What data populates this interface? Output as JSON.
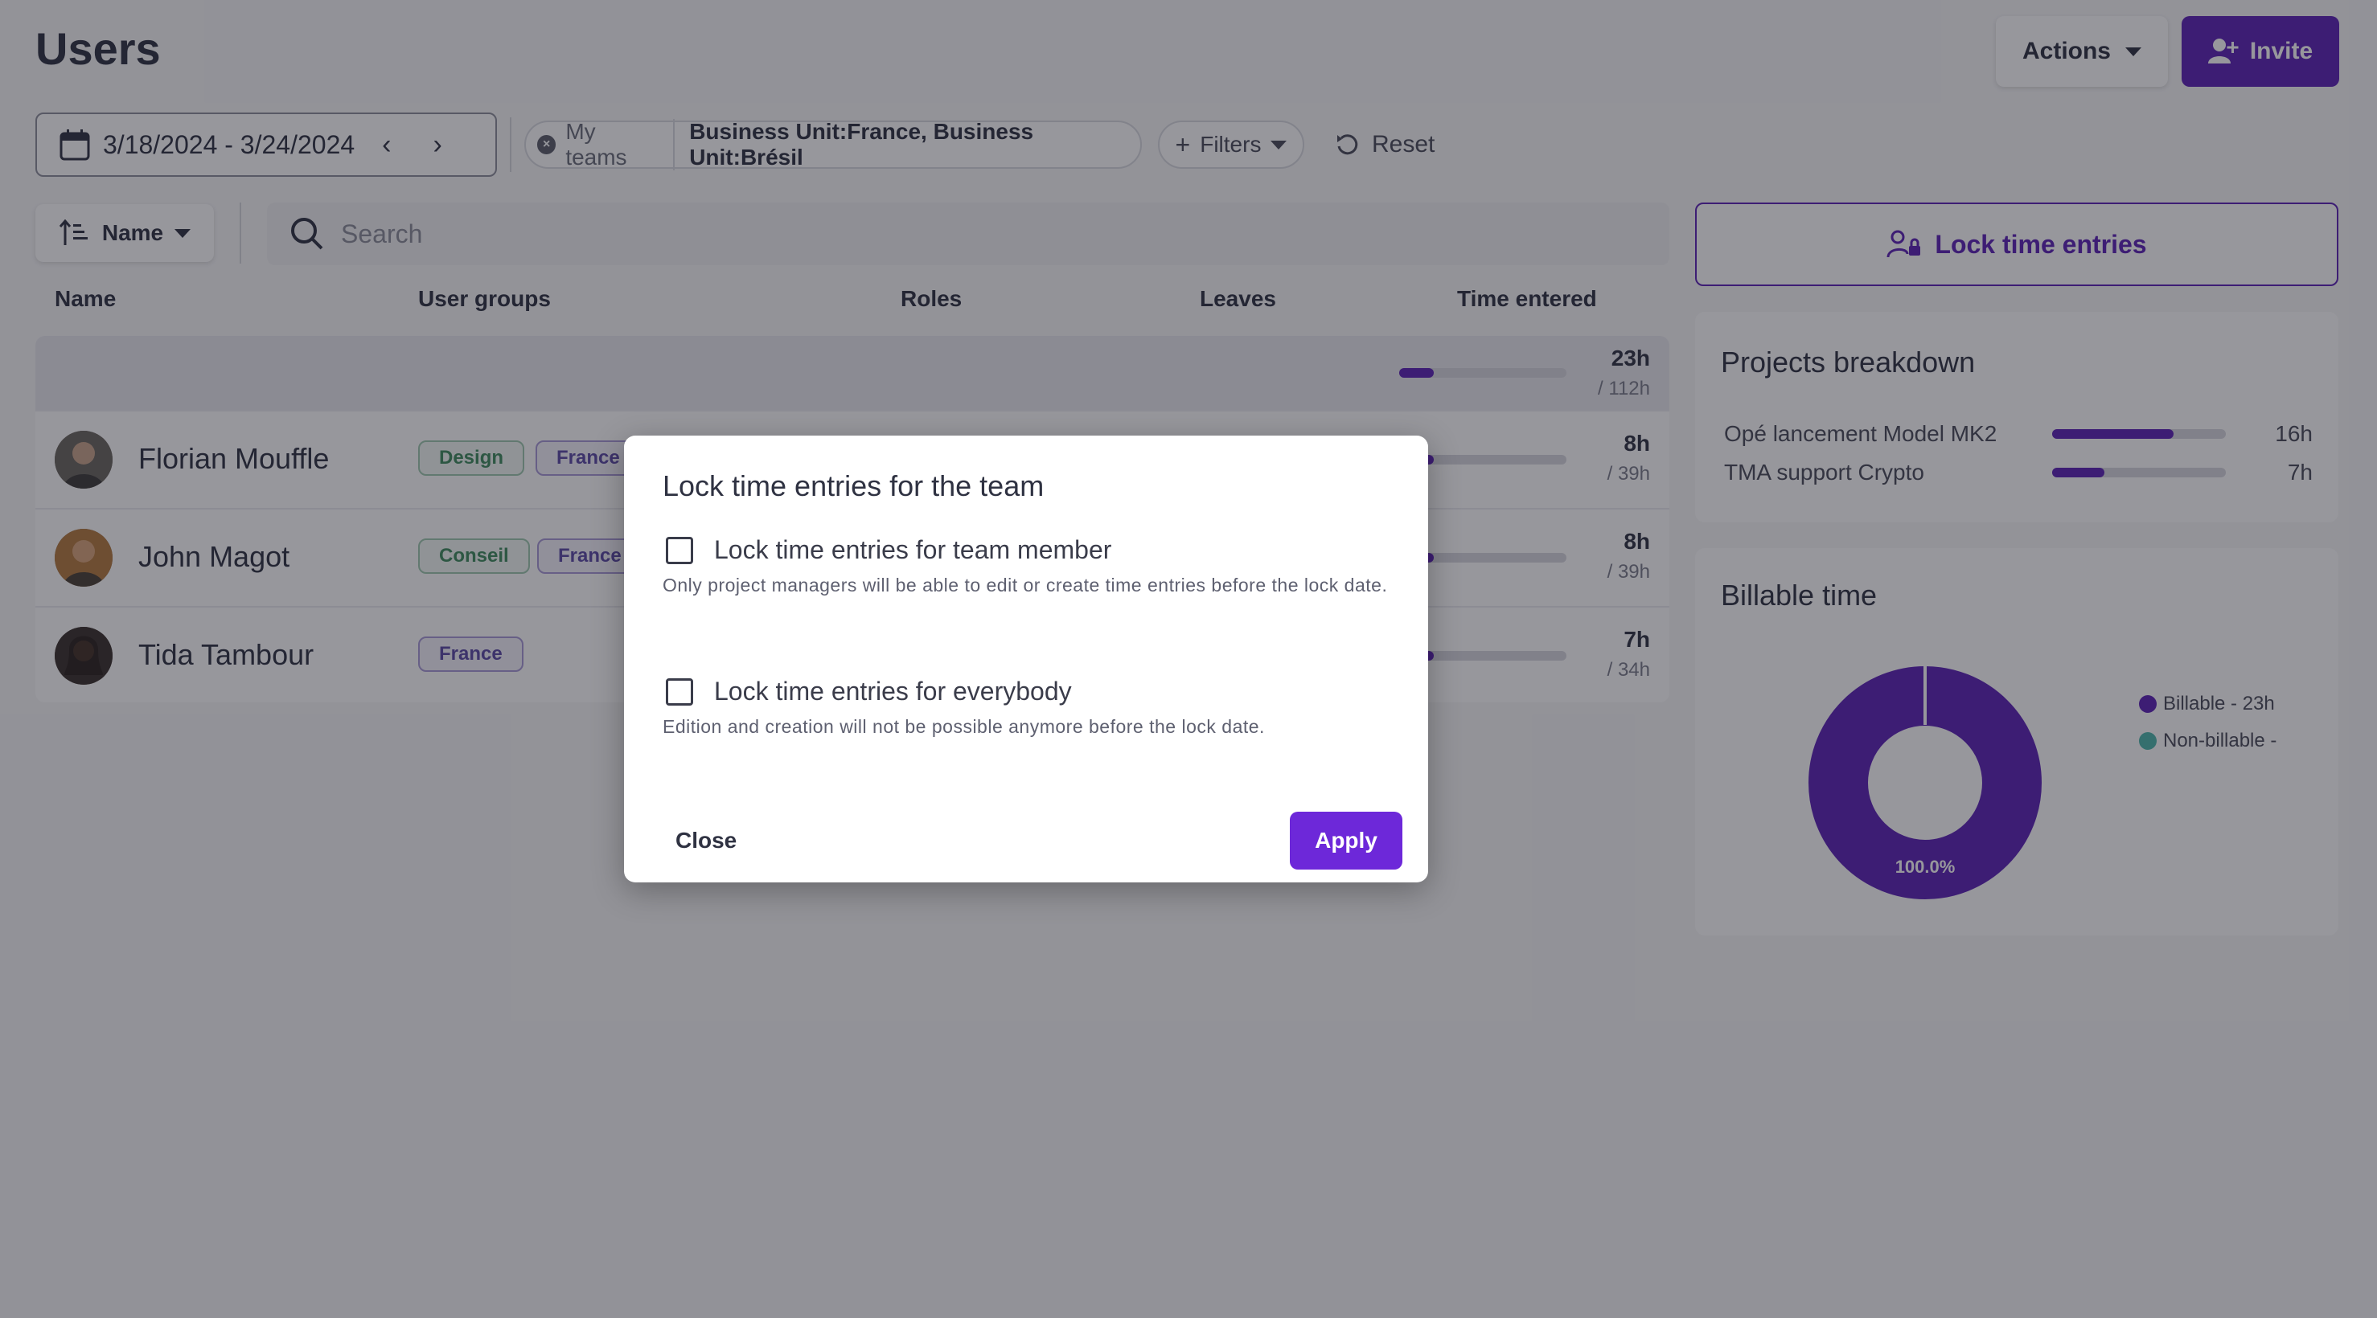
{
  "header": {
    "title": "Users",
    "actions_label": "Actions",
    "invite_label": "Invite"
  },
  "filters": {
    "date_range": "3/18/2024 - 3/24/2024",
    "teams_chip_label": "My teams",
    "teams_chip_value": "Business Unit:France, Business Unit:Brésil",
    "filters_label": "Filters",
    "reset_label": "Reset"
  },
  "sort": {
    "label": "Name"
  },
  "search": {
    "placeholder": "Search"
  },
  "table": {
    "columns": [
      "Name",
      "User groups",
      "Roles",
      "Leaves",
      "Time entered"
    ],
    "total": {
      "time": "23h",
      "capacity": "/ 112h",
      "progress": 0.205
    },
    "rows": [
      {
        "name": "Florian Mouffle",
        "groups": [
          "Design",
          "France"
        ],
        "time": "8h",
        "capacity": "/ 39h",
        "progress": 0.205
      },
      {
        "name": "John Magot",
        "groups": [
          "Conseil",
          "France"
        ],
        "time": "8h",
        "capacity": "/ 39h",
        "progress": 0.205
      },
      {
        "name": "Tida Tambour",
        "groups": [
          "France"
        ],
        "time": "7h",
        "capacity": "/ 34h",
        "progress": 0.206
      }
    ]
  },
  "side": {
    "lock_button_label": "Lock time entries",
    "projects": {
      "title": "Projects breakdown",
      "items": [
        {
          "name": "Opé lancement Model MK2",
          "value": "16h",
          "progress": 0.7
        },
        {
          "name": "TMA support Crypto",
          "value": "7h",
          "progress": 0.3
        }
      ]
    },
    "billable": {
      "title": "Billable time",
      "center_label": "100.0%",
      "legend": [
        {
          "label": "Billable - 23h",
          "color": "#5b21b6"
        },
        {
          "label": "Non-billable -",
          "color": "#4db6ac"
        }
      ],
      "billable_fraction": 1.0
    }
  },
  "modal": {
    "title": "Lock time entries for the team",
    "option1_label": "Lock time entries for team member",
    "option1_desc": "Only project managers will be able to edit or create time entries before the lock date.",
    "option2_label": "Lock time entries for everybody",
    "option2_desc": "Edition and creation will not be possible anymore before the lock date.",
    "close_label": "Close",
    "apply_label": "Apply"
  },
  "colors": {
    "accent": "#5b21b6",
    "apply": "#6d28d9",
    "non_billable": "#4db6ac"
  }
}
